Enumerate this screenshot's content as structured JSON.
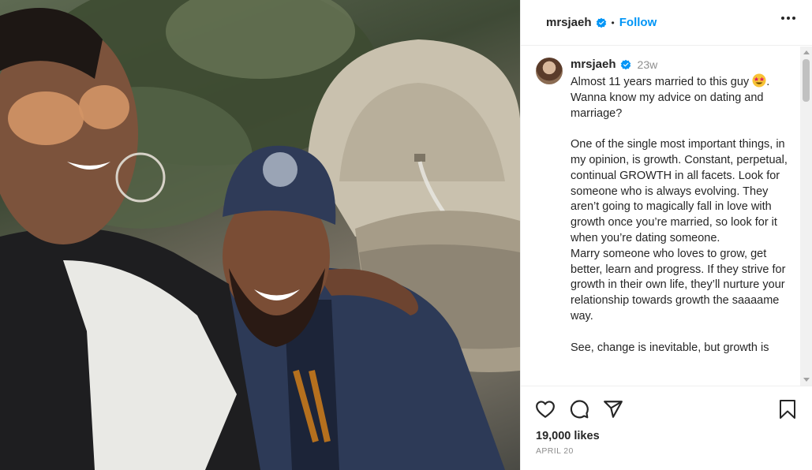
{
  "post": {
    "username": "mrsjaeh",
    "follow_label": "Follow",
    "separator": "•",
    "time_ago": "23w",
    "caption_line1": "Almost 11 years married to this guy",
    "caption_line1_end": ".",
    "caption_rest": "Wanna know my advice on dating and marriage?\n\nOne of the single most important things, in my opinion, is growth. Constant, perpetual, continual GROWTH in all facets. Look for someone who is always evolving. They aren’t going to magically fall in love with growth once you’re married, so look for it when you’re dating someone.\nMarry someone who loves to grow, get better, learn and progress. If they strive for growth in their own life, they’ll nurture your relationship towards growth the saaaame way.\n\nSee, change is inevitable, but growth is",
    "likes": "19,000 likes",
    "date": "APRIL 20"
  },
  "icons": {
    "verified": "verified-badge-icon",
    "more": "more-options-icon",
    "like": "heart-icon",
    "comment": "comment-icon",
    "share": "share-icon",
    "save": "bookmark-icon",
    "emoji": "star-struck-emoji"
  },
  "colors": {
    "accent": "#0095f6",
    "text": "#262626",
    "muted": "#8e8e8e",
    "border": "#efefef"
  }
}
